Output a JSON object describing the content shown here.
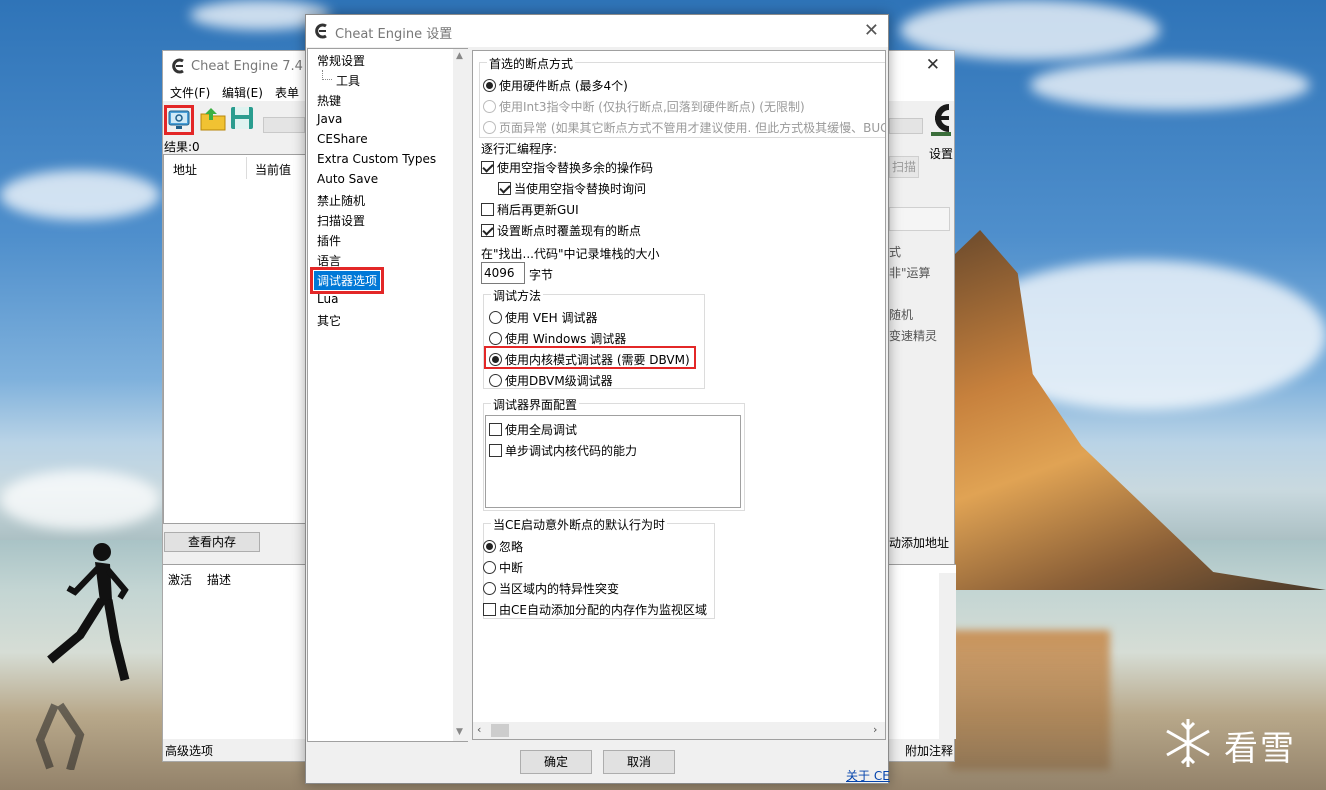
{
  "main_window": {
    "title": "Cheat Engine 7.4",
    "menu": [
      "文件(F)",
      "编辑(E)",
      "表单"
    ],
    "results_label": "结果:0",
    "columns": [
      "地址",
      "当前值"
    ],
    "view_memory_button": "查看内存",
    "bottom_columns": [
      "激活",
      "描述"
    ],
    "advanced_options": "高级选项",
    "attach_comment": "附加注释",
    "settings_label": "设置",
    "scan_button": "扫描",
    "side_texts": [
      "式",
      "非\"运算",
      "随机",
      "变速精灵"
    ],
    "add_address": "动添加地址"
  },
  "dialog": {
    "title": "Cheat Engine 设置",
    "tree_items": [
      "常规设置",
      "工具",
      "热键",
      "Java",
      "CEShare",
      "Extra Custom Types",
      "Auto Save",
      "禁止随机",
      "扫描设置",
      "插件",
      "语言",
      "调试器选项",
      "Lua",
      "其它"
    ],
    "selected_item": "调试器选项",
    "breakpoint_group": {
      "title": "首选的断点方式",
      "options": [
        "使用硬件断点 (最多4个)",
        "使用Int3指令中断 (仅执行断点,回落到硬件断点) (无限制)",
        "页面异常 (如果其它断点方式不管用才建议使用. 但此方式极其缓慢、BUG"
      ],
      "selected": 0
    },
    "stepping_label": "逐行汇编程序:",
    "use_nop_replace": "使用空指令替换多余的操作码",
    "ask_on_nop_replace": "当使用空指令替换时询问",
    "update_gui_later": "稍后再更新GUI",
    "overwrite_breakpoints": "设置断点时覆盖现有的断点",
    "stack_size_label": "在\"找出...代码\"中记录堆栈的大小",
    "stack_size_value": "4096",
    "stack_size_unit": "字节",
    "debug_method_group": {
      "title": "调试方法",
      "options": [
        "使用 VEH 调试器",
        "使用 Windows 调试器",
        "使用内核模式调试器 (需要 DBVM)",
        "使用DBVM级调试器"
      ],
      "selected": 2
    },
    "debugger_interface_group": {
      "title": "调试器界面配置",
      "options": [
        "使用全局调试",
        "单步调试内核代码的能力"
      ]
    },
    "unexpected_breakpoint_group": {
      "title": "当CE启动意外断点的默认行为时",
      "options": [
        "忽略",
        "中断",
        "当区域内的特异性突变"
      ],
      "selected": 0,
      "auto_add_region": "由CE自动添加分配的内存作为监视区域"
    },
    "ok_button": "确定",
    "cancel_button": "取消",
    "about_link": "关于 CE"
  },
  "watermark": {
    "text": "看雪"
  }
}
